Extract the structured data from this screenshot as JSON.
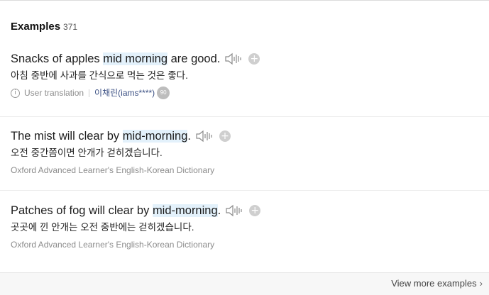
{
  "header": {
    "title": "Examples",
    "count": "371"
  },
  "examples": [
    {
      "pre": "Snacks of apples ",
      "highlight": "mid morning",
      "post": " are good.",
      "translation": "아침 중반에 사과를 간식으로 먹는 것은 좋다.",
      "source_type": "User translation",
      "user": "이채린(iams****)",
      "badge": "90"
    },
    {
      "pre": "The mist will clear by ",
      "highlight": "mid-morning",
      "post": ".",
      "translation": "오전 중간쯤이면 안개가 걷히겠습니다.",
      "source": "Oxford Advanced Learner's English-Korean Dictionary"
    },
    {
      "pre": "Patches of fog will clear by ",
      "highlight": "mid-morning",
      "post": ".",
      "translation": "곳곳에 낀 안개는 오전 중반에는 걷히겠습니다.",
      "source": "Oxford Advanced Learner's English-Korean Dictionary"
    }
  ],
  "icons": {
    "speaker": "speaker-icon",
    "add": "plus-icon",
    "info": "info-icon",
    "chevron": "chevron-right-icon"
  },
  "footer": {
    "more_label": "View more examples"
  }
}
